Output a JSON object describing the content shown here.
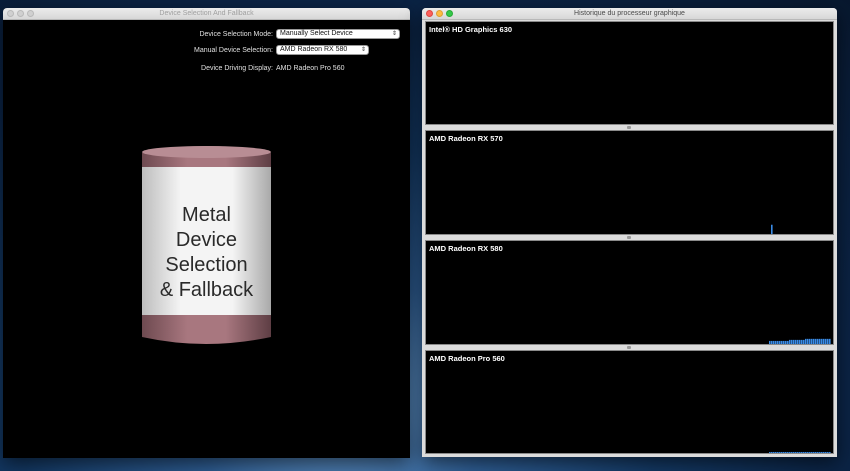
{
  "left_window": {
    "title": "Device Selection And Fallback",
    "mode_label": "Device Selection Mode:",
    "mode_value": "Manually Select Device",
    "manual_label": "Manual Device Selection:",
    "manual_value": "AMD Radeon RX 580",
    "driving_label": "Device Driving Display:",
    "driving_value": "AMD Radeon Pro 560",
    "can_lines": [
      "Metal",
      "Device",
      "Selection",
      "& Fallback"
    ]
  },
  "right_window": {
    "title": "Historique du processeur graphique",
    "panels": [
      {
        "name": "Intel® HD Graphics 630",
        "history": []
      },
      {
        "name": "AMD Radeon RX 570",
        "history": [
          0.09
        ]
      },
      {
        "name": "AMD Radeon RX 580",
        "history": [
          0.03,
          0.03,
          0.03,
          0.03,
          0.03,
          0.03,
          0.03,
          0.03,
          0.03,
          0.03,
          0.04,
          0.04,
          0.04,
          0.04,
          0.04,
          0.04,
          0.04,
          0.04,
          0.05,
          0.05,
          0.05,
          0.05,
          0.05,
          0.05,
          0.05,
          0.05,
          0.05,
          0.05,
          0.05,
          0.05,
          0.05
        ]
      },
      {
        "name": "AMD Radeon Pro 560",
        "history": [
          0.01,
          0.01,
          0.01,
          0.01,
          0.01,
          0.01,
          0.01,
          0.01,
          0.01,
          0.01,
          0.01,
          0.01,
          0.01,
          0.01,
          0.01,
          0.01,
          0.01,
          0.01,
          0.01,
          0.01,
          0.01,
          0.01,
          0.01,
          0.01,
          0.01,
          0.01,
          0.01,
          0.01,
          0.01,
          0.01,
          0.01
        ]
      }
    ]
  },
  "colors": {
    "graph_bar": "#3a8be6",
    "can_band": "#9c6a72",
    "can_body": "#efefef"
  }
}
